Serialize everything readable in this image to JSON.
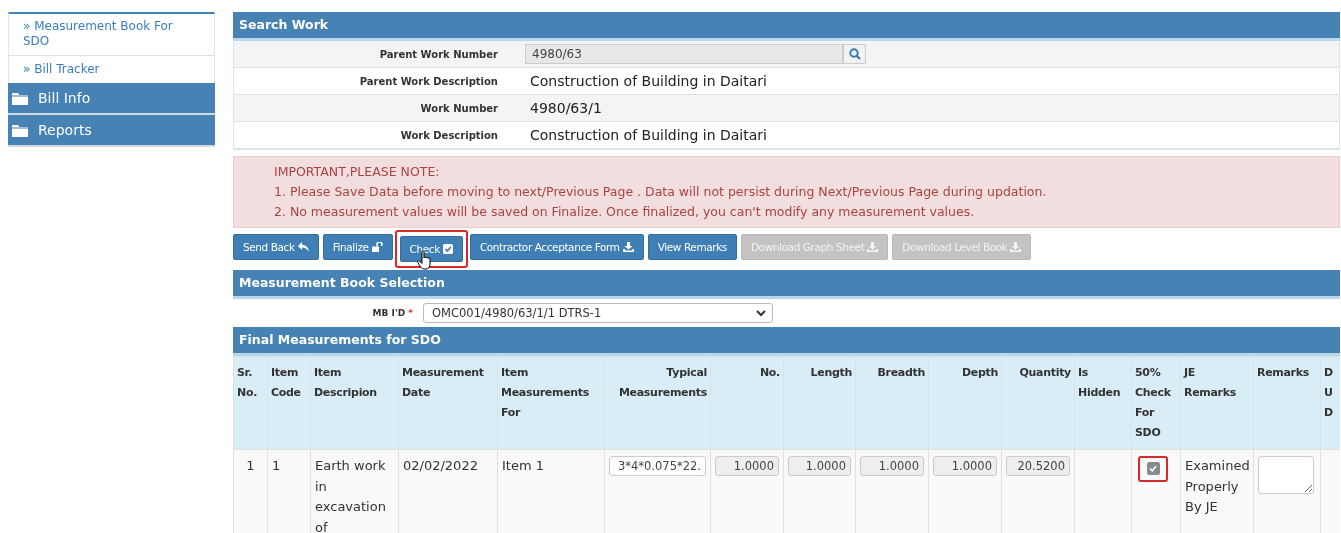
{
  "sidebar": {
    "links": [
      {
        "label": "» Measurement Book For SDO"
      },
      {
        "label": "» Bill Tracker"
      }
    ],
    "sections": [
      {
        "label": "Bill Info"
      },
      {
        "label": "Reports"
      }
    ]
  },
  "search_work": {
    "title": "Search Work",
    "fields": [
      {
        "label": "Parent Work Number",
        "kind": "search",
        "value": "4980/63"
      },
      {
        "label": "Parent Work Description",
        "kind": "text",
        "value": "Construction of Building in Daitari"
      },
      {
        "label": "Work Number",
        "kind": "text",
        "value": "4980/63/1"
      },
      {
        "label": "Work Description",
        "kind": "text",
        "value": "Construction of Building in Daitari"
      }
    ]
  },
  "notice": {
    "heading": "IMPORTANT,PLEASE NOTE:",
    "lines": [
      "1. Please Save Data before moving to next/Previous Page . Data will not persist during Next/Previous Page during updation.",
      "2. No measurement values will be saved on Finalize. Once finalized, you can't modify any measurement values."
    ]
  },
  "actions": [
    {
      "label": "Send Back",
      "disabled": false,
      "highlighted": false
    },
    {
      "label": "Finalize",
      "disabled": false,
      "highlighted": false
    },
    {
      "label": "Check",
      "disabled": false,
      "highlighted": true
    },
    {
      "label": "Contractor Acceptance Form",
      "disabled": false,
      "highlighted": false
    },
    {
      "label": "View Remarks",
      "disabled": false,
      "highlighted": false
    },
    {
      "label": "Download Graph Sheet",
      "disabled": true,
      "highlighted": false
    },
    {
      "label": "Download Level Book",
      "disabled": true,
      "highlighted": false
    }
  ],
  "mb_selection": {
    "title": "Measurement Book Selection",
    "label": "MB I'D",
    "required_mark": "*",
    "value": "OMC001/4980/63/1/1 DTRS-1"
  },
  "final_measurements": {
    "title": "Final Measurements for SDO",
    "columns": [
      {
        "label": "Sr. No."
      },
      {
        "label": "Item Code"
      },
      {
        "label": "Item Descripion"
      },
      {
        "label": "Measurement Date"
      },
      {
        "label": "Item Measurements For"
      },
      {
        "label": "Typical Measurements"
      },
      {
        "label": "No."
      },
      {
        "label": "Length"
      },
      {
        "label": "Breadth"
      },
      {
        "label": "Depth"
      },
      {
        "label": "Quantity"
      },
      {
        "label": "Is Hidden"
      },
      {
        "label": "50% Check For SDO"
      },
      {
        "label": "JE Remarks"
      },
      {
        "label": "Remarks"
      },
      {
        "label": "D U D"
      }
    ],
    "rows": [
      {
        "cells": [
          {
            "kind": "text",
            "value": "1"
          },
          {
            "kind": "text",
            "value": "1"
          },
          {
            "kind": "text",
            "value": "Earth work in excavation of"
          },
          {
            "kind": "text",
            "value": "02/02/2022"
          },
          {
            "kind": "text",
            "value": "Item 1"
          },
          {
            "kind": "input",
            "value": "3*4*0.075*22."
          },
          {
            "kind": "readonly",
            "value": "1.0000"
          },
          {
            "kind": "readonly",
            "value": "1.0000"
          },
          {
            "kind": "readonly",
            "value": "1.0000"
          },
          {
            "kind": "readonly",
            "value": "1.0000"
          },
          {
            "kind": "readonly",
            "value": "20.5200"
          },
          {
            "kind": "empty"
          },
          {
            "kind": "checkbox",
            "checked": true,
            "disabled": true,
            "highlighted": true
          },
          {
            "kind": "text",
            "value": "Examined Properly By JE"
          },
          {
            "kind": "textarea"
          },
          {
            "kind": "empty"
          }
        ]
      }
    ]
  }
}
